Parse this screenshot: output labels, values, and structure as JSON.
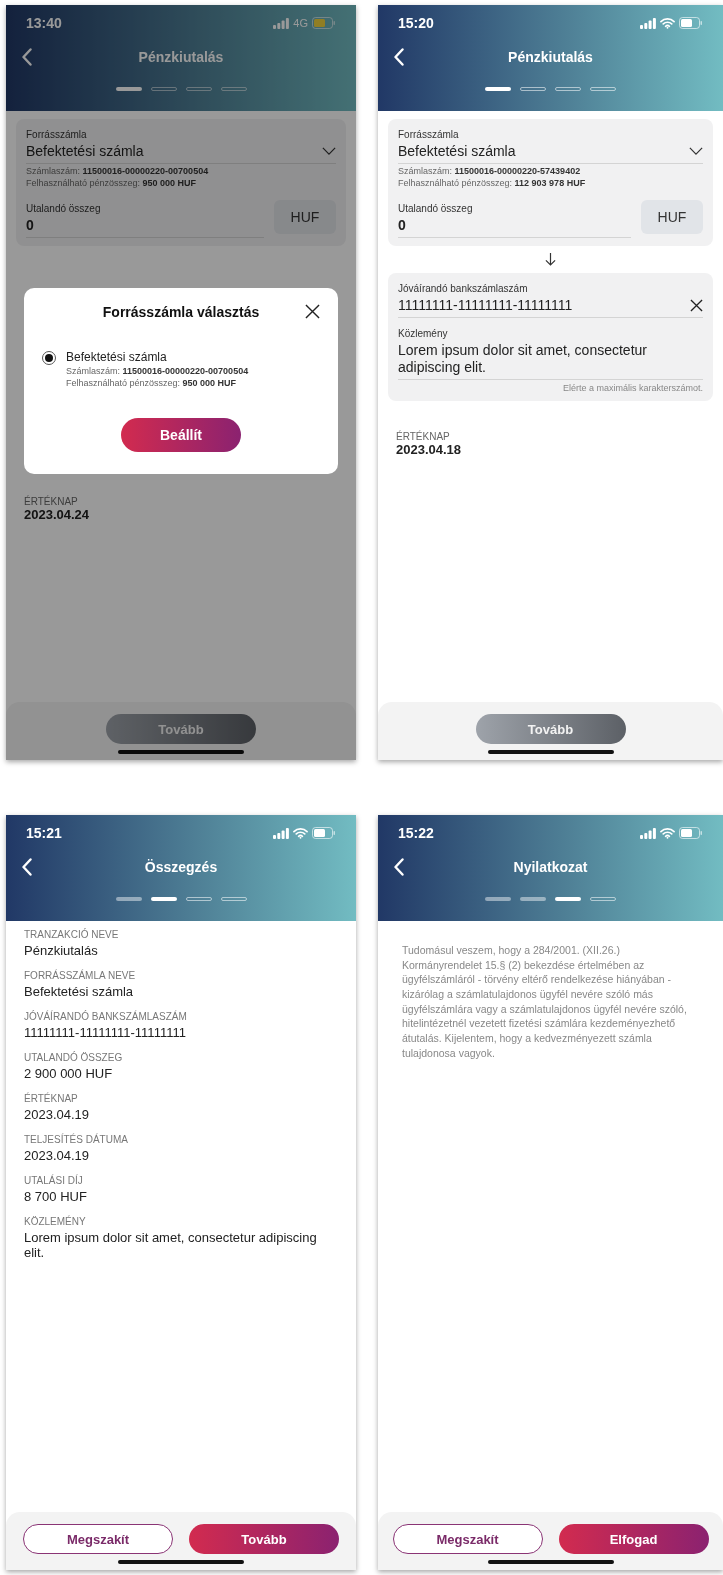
{
  "screens": [
    {
      "kind": "form",
      "status": {
        "time": "13:40",
        "network": "4G"
      },
      "title": "Pénzkiutalás",
      "steps": [
        {
          "current": true,
          "done": false
        },
        {
          "current": false,
          "done": false
        },
        {
          "current": false,
          "done": false
        },
        {
          "current": false,
          "done": false
        }
      ],
      "source": {
        "label": "Forrásszámla",
        "value": "Befektetési számla",
        "account_line": "Számlaszám: **11500016-00000220-00700504**",
        "balance_line": "Felhasználható pénzösszeg: **950 000 HUF**"
      },
      "amount": {
        "label": "Utalandó összeg",
        "value": "0",
        "currency": "HUF"
      },
      "value_date": {
        "label": "ÉRTÉKNAP",
        "value": "2023.04.24"
      },
      "buttons": [
        {
          "label": "Tovább",
          "kind": "primary",
          "disabled": true
        }
      ],
      "modal": {
        "title": "Forrásszámla választás",
        "options": [
          {
            "name": "Befektetési számla",
            "account_line": "Számlaszám: **11500016-00000220-00700504**",
            "balance_line": "Felhasználható pénzösszeg: **950 000 HUF**",
            "selected": true
          }
        ],
        "button": "Beállít"
      }
    },
    {
      "kind": "form",
      "status": {
        "time": "15:20"
      },
      "title": "Pénzkiutalás",
      "steps": [
        {
          "current": true,
          "done": false
        },
        {
          "current": false,
          "done": false
        },
        {
          "current": false,
          "done": false
        },
        {
          "current": false,
          "done": false
        }
      ],
      "source": {
        "label": "Forrásszámla",
        "value": "Befektetési számla",
        "account_line": "Számlaszám: **11500016-00000220-57439402**",
        "balance_line": "Felhasználható pénzösszeg: **112 903 978 HUF**"
      },
      "amount": {
        "label": "Utalandó összeg",
        "value": "0",
        "currency": "HUF"
      },
      "beneficiary": {
        "label": "Jóváírandó bankszámlaszám",
        "value": "11111111-11111111-11111111",
        "comment_label": "Közlemény",
        "comment": "Lorem ipsum dolor sit amet, consectetur adipiscing elit.",
        "hint": "Elérte a maximális karakterszámot."
      },
      "value_date": {
        "label": "ÉRTÉKNAP",
        "value": "2023.04.18"
      },
      "buttons": [
        {
          "label": "Tovább",
          "kind": "primary",
          "disabled": true
        }
      ]
    },
    {
      "kind": "summary",
      "status": {
        "time": "15:21"
      },
      "title": "Összegzés",
      "steps": [
        {
          "current": false,
          "done": true
        },
        {
          "current": true,
          "done": false
        },
        {
          "current": false,
          "done": false
        },
        {
          "current": false,
          "done": false
        }
      ],
      "items": [
        {
          "label": "TRANZAKCIÓ NEVE",
          "value": "Pénzkiutalás"
        },
        {
          "label": "FORRÁSSZÁMLA NEVE",
          "value": "Befektetési számla"
        },
        {
          "label": "JÓVÁÍRANDÓ BANKSZÁMLASZÁM",
          "value": "11111111-11111111-11111111"
        },
        {
          "label": "UTALANDÓ ÖSSZEG",
          "value": "2 900 000 HUF"
        },
        {
          "label": "ÉRTÉKNAP",
          "value": "2023.04.19"
        },
        {
          "label": "TELJESÍTÉS DÁTUMA",
          "value": "2023.04.19"
        },
        {
          "label": "UTALÁSI DÍJ",
          "value": "8 700 HUF"
        },
        {
          "label": "KÖZLEMÉNY",
          "value": "Lorem ipsum dolor sit amet, consectetur adipiscing elit."
        }
      ],
      "buttons": [
        {
          "label": "Megszakít",
          "kind": "secondary",
          "disabled": false
        },
        {
          "label": "Tovább",
          "kind": "primary",
          "disabled": false
        }
      ]
    },
    {
      "kind": "declaration",
      "status": {
        "time": "15:22"
      },
      "title": "Nyilatkozat",
      "steps": [
        {
          "current": false,
          "done": true
        },
        {
          "current": false,
          "done": true
        },
        {
          "current": true,
          "done": false
        },
        {
          "current": false,
          "done": false
        }
      ],
      "text": "Tudomásul veszem, hogy a 284/2001. (XII.26.) Kormányrendelet 15.§ (2) bekezdése értelmében az ügyfélszámláról - törvény eltérő rendelkezése hiányában - kizárólag a számlatulajdonos ügyfél nevére szóló más ügyfélszámlára vagy a számlatulajdonos ügyfél nevére szóló, hitelintézetnél vezetett fizetési számlára kezdeményezhető átutalás. Kijelentem, hogy a kedvezményezett számla tulajdonosa vagyok.",
      "buttons": [
        {
          "label": "Megszakít",
          "kind": "secondary",
          "disabled": false
        },
        {
          "label": "Elfogad",
          "kind": "primary",
          "disabled": false
        }
      ]
    }
  ]
}
